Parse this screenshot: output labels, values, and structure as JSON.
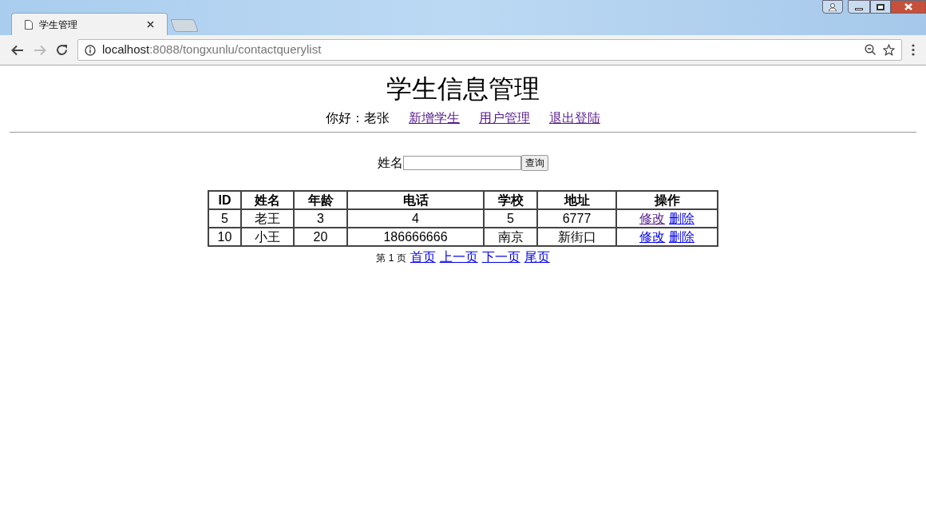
{
  "browser": {
    "tab": {
      "title": "学生管理"
    },
    "address": {
      "host": "localhost",
      "path": ":8088/tongxunlu/contactquerylist"
    }
  },
  "page": {
    "title": "学生信息管理",
    "greeting": "你好：老张",
    "nav_links": [
      {
        "label": "新增学生",
        "visited": true
      },
      {
        "label": "用户管理",
        "visited": true
      },
      {
        "label": "退出登陆",
        "visited": true
      }
    ],
    "search": {
      "label": "姓名",
      "button": "查询"
    },
    "table": {
      "columns": [
        "ID",
        "姓名",
        "年龄",
        "电话",
        "学校",
        "地址",
        "操作"
      ],
      "rows": [
        {
          "cells": [
            "5",
            "老王",
            "3",
            "4",
            "5",
            "6777"
          ],
          "actions": [
            {
              "label": "修改",
              "visited": true
            },
            {
              "label": "删除",
              "visited": false
            }
          ]
        },
        {
          "cells": [
            "10",
            "小王",
            "20",
            "186666666",
            "南京",
            "新街口"
          ],
          "actions": [
            {
              "label": "修改",
              "visited": false
            },
            {
              "label": "删除",
              "visited": false
            }
          ]
        }
      ]
    },
    "pagination": {
      "info": "第 1 页",
      "links": [
        {
          "label": "首页",
          "visited": false
        },
        {
          "label": "上一页",
          "visited": false
        },
        {
          "label": "下一页",
          "visited": false
        },
        {
          "label": "尾页",
          "visited": false
        }
      ]
    }
  }
}
